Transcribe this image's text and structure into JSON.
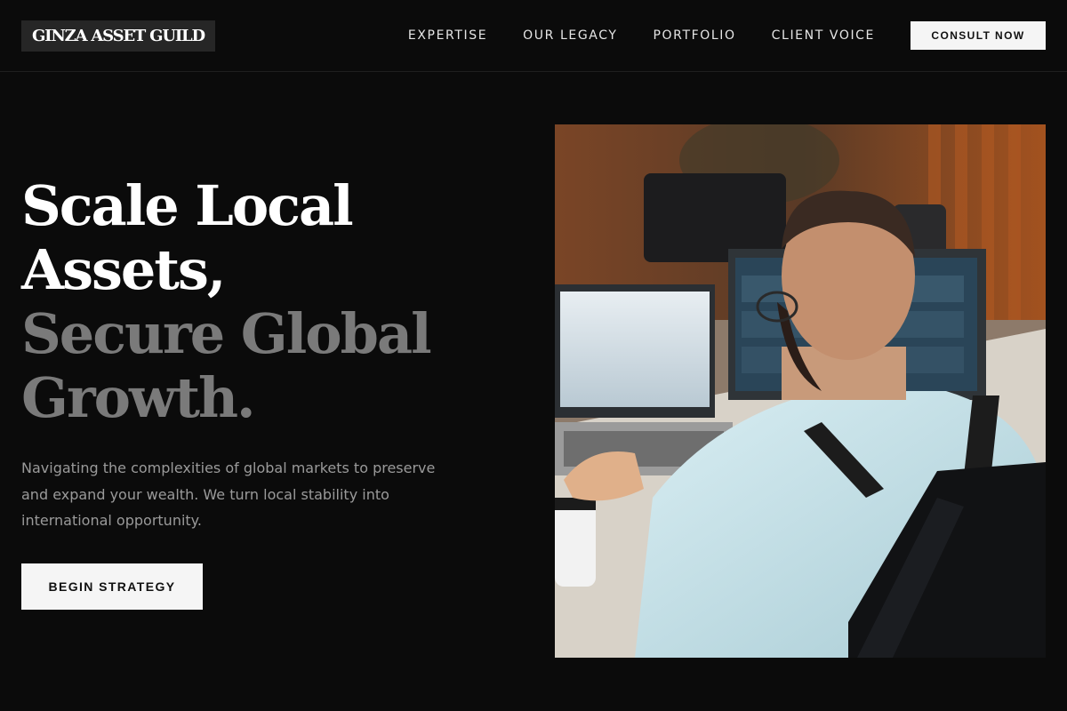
{
  "brand": {
    "name": "GINZA ASSET GUILD"
  },
  "nav": {
    "links": [
      {
        "label": "EXPERTISE"
      },
      {
        "label": "OUR LEGACY"
      },
      {
        "label": "PORTFOLIO"
      },
      {
        "label": "CLIENT VOICE"
      }
    ],
    "cta_label": "CONSULT NOW"
  },
  "hero": {
    "headline_lines": [
      "Scale Local",
      "Assets,",
      "Secure Global",
      "Growth."
    ],
    "subcopy": "Navigating the complexities of global markets to preserve and expand your wealth. We turn local stability into international opportunity.",
    "cta_label": "BEGIN STRATEGY"
  },
  "colors": {
    "background": "#0b0b0b",
    "text_primary": "#ffffff",
    "text_muted": "#7a7a7a",
    "button_bg": "#f5f5f5",
    "button_text": "#111111"
  }
}
